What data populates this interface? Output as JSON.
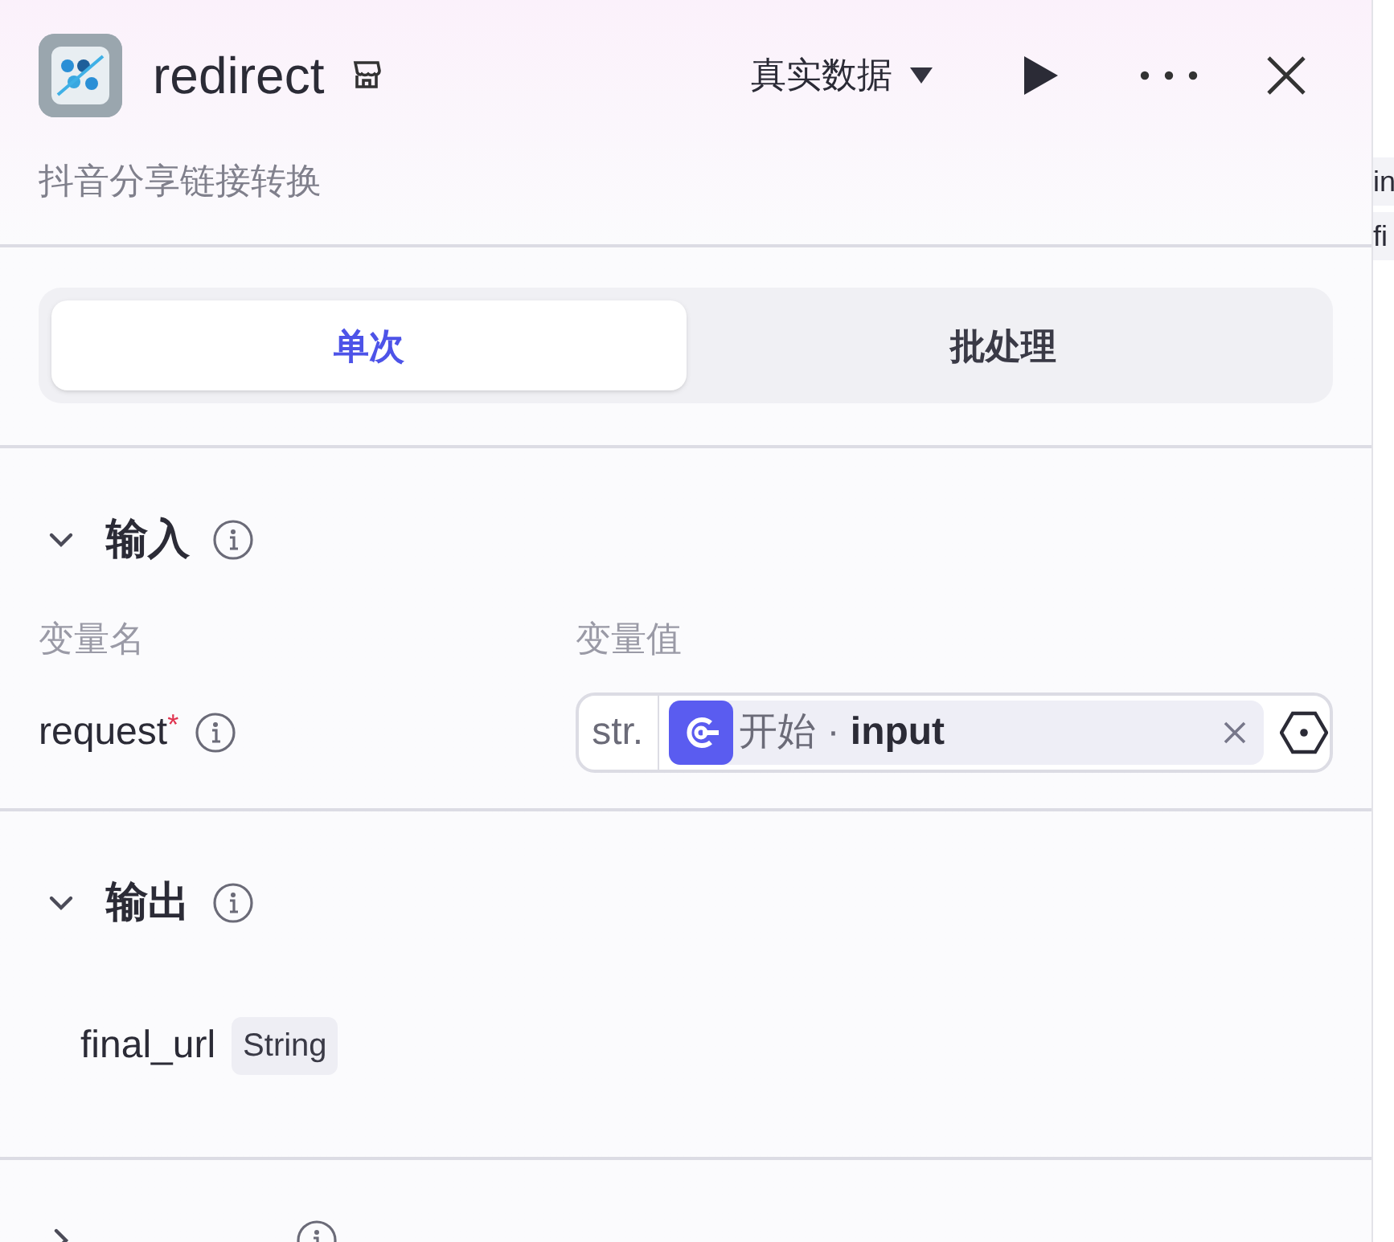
{
  "header": {
    "title": "redirect",
    "description": "抖音分享链接转换",
    "data_mode": "真实数据"
  },
  "tabs": [
    {
      "label": "单次",
      "selected": true
    },
    {
      "label": "批处理",
      "selected": false
    }
  ],
  "input_section": {
    "title": "输入",
    "expanded": true,
    "columns": [
      "变量名",
      "变量值"
    ],
    "rows": [
      {
        "name": "request",
        "required": true,
        "required_mark": "*",
        "type": "str.",
        "source": "开始",
        "separator": "·",
        "variable": "input"
      }
    ]
  },
  "output_section": {
    "title": "输出",
    "expanded": true,
    "items": [
      {
        "name": "final_url",
        "type": "String"
      }
    ]
  },
  "error_section": {
    "expanded": false
  },
  "background_panel": {
    "items": [
      "in",
      "fi"
    ]
  }
}
